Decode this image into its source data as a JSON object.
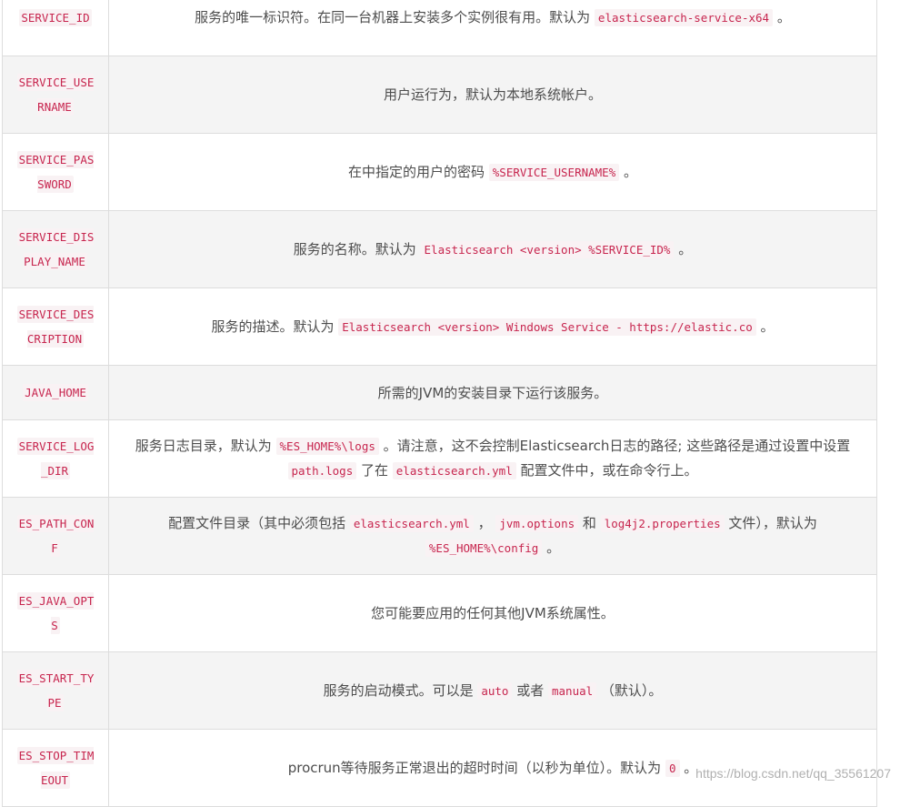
{
  "rows": [
    {
      "name": "SERVICE_ID",
      "desc": [
        {
          "t": "服务的唯一标识符。在同一台机器上安装多个实例很有用。默认为 "
        },
        {
          "c": "elasticsearch-service-x64"
        },
        {
          "t": " 。"
        }
      ]
    },
    {
      "name": "SERVICE_USERNAME",
      "desc": [
        {
          "t": "用户运行为，默认为本地系统帐户。"
        }
      ]
    },
    {
      "name": "SERVICE_PASSWORD",
      "desc": [
        {
          "t": "在中指定的用户的密码 "
        },
        {
          "c": "%SERVICE_USERNAME%"
        },
        {
          "t": " 。"
        }
      ]
    },
    {
      "name": "SERVICE_DISPLAY_NAME",
      "desc": [
        {
          "t": "服务的名称。默认为 "
        },
        {
          "c": "Elasticsearch <version> %SERVICE_ID%"
        },
        {
          "t": " 。"
        }
      ]
    },
    {
      "name": "SERVICE_DESCRIPTION",
      "desc": [
        {
          "t": "服务的描述。默认为 "
        },
        {
          "c": "Elasticsearch <version> Windows Service - https://elastic.co"
        },
        {
          "t": " 。"
        }
      ]
    },
    {
      "name": "JAVA_HOME",
      "short": true,
      "desc": [
        {
          "t": "所需的JVM的安装目录下运行该服务。"
        }
      ]
    },
    {
      "name": "SERVICE_LOG_DIR",
      "desc": [
        {
          "t": "服务日志目录，默认为 "
        },
        {
          "c": "%ES_HOME%\\logs"
        },
        {
          "t": " 。请注意，这不会控制Elasticsearch日志的路径; 这些路径是通过设置中设置 "
        },
        {
          "c": "path.logs"
        },
        {
          "t": " 了在 "
        },
        {
          "c": "elasticsearch.yml"
        },
        {
          "t": " 配置文件中，或在命令行上。"
        }
      ]
    },
    {
      "name": "ES_PATH_CONF",
      "desc": [
        {
          "t": "配置文件目录（其中必须包括 "
        },
        {
          "c": "elasticsearch.yml"
        },
        {
          "t": " ， "
        },
        {
          "c": "jvm.options"
        },
        {
          "t": " 和 "
        },
        {
          "c": "log4j2.properties"
        },
        {
          "t": " 文件），默认为 "
        },
        {
          "c": "%ES_HOME%\\config"
        },
        {
          "t": " 。"
        }
      ]
    },
    {
      "name": "ES_JAVA_OPTS",
      "desc": [
        {
          "t": "您可能要应用的任何其他JVM系统属性。"
        }
      ]
    },
    {
      "name": "ES_START_TYPE",
      "desc": [
        {
          "t": "服务的启动模式。可以是 "
        },
        {
          "c": "auto"
        },
        {
          "t": " 或者 "
        },
        {
          "c": "manual"
        },
        {
          "t": " （默认）。"
        }
      ]
    },
    {
      "name": "ES_STOP_TIMEOUT",
      "desc": [
        {
          "t": "procrun等待服务正常退出的超时时间（以秒为单位）。默认为 "
        },
        {
          "c": "0"
        },
        {
          "t": " 。"
        }
      ]
    }
  ],
  "watermark": "https://blog.csdn.net/qq_35561207"
}
